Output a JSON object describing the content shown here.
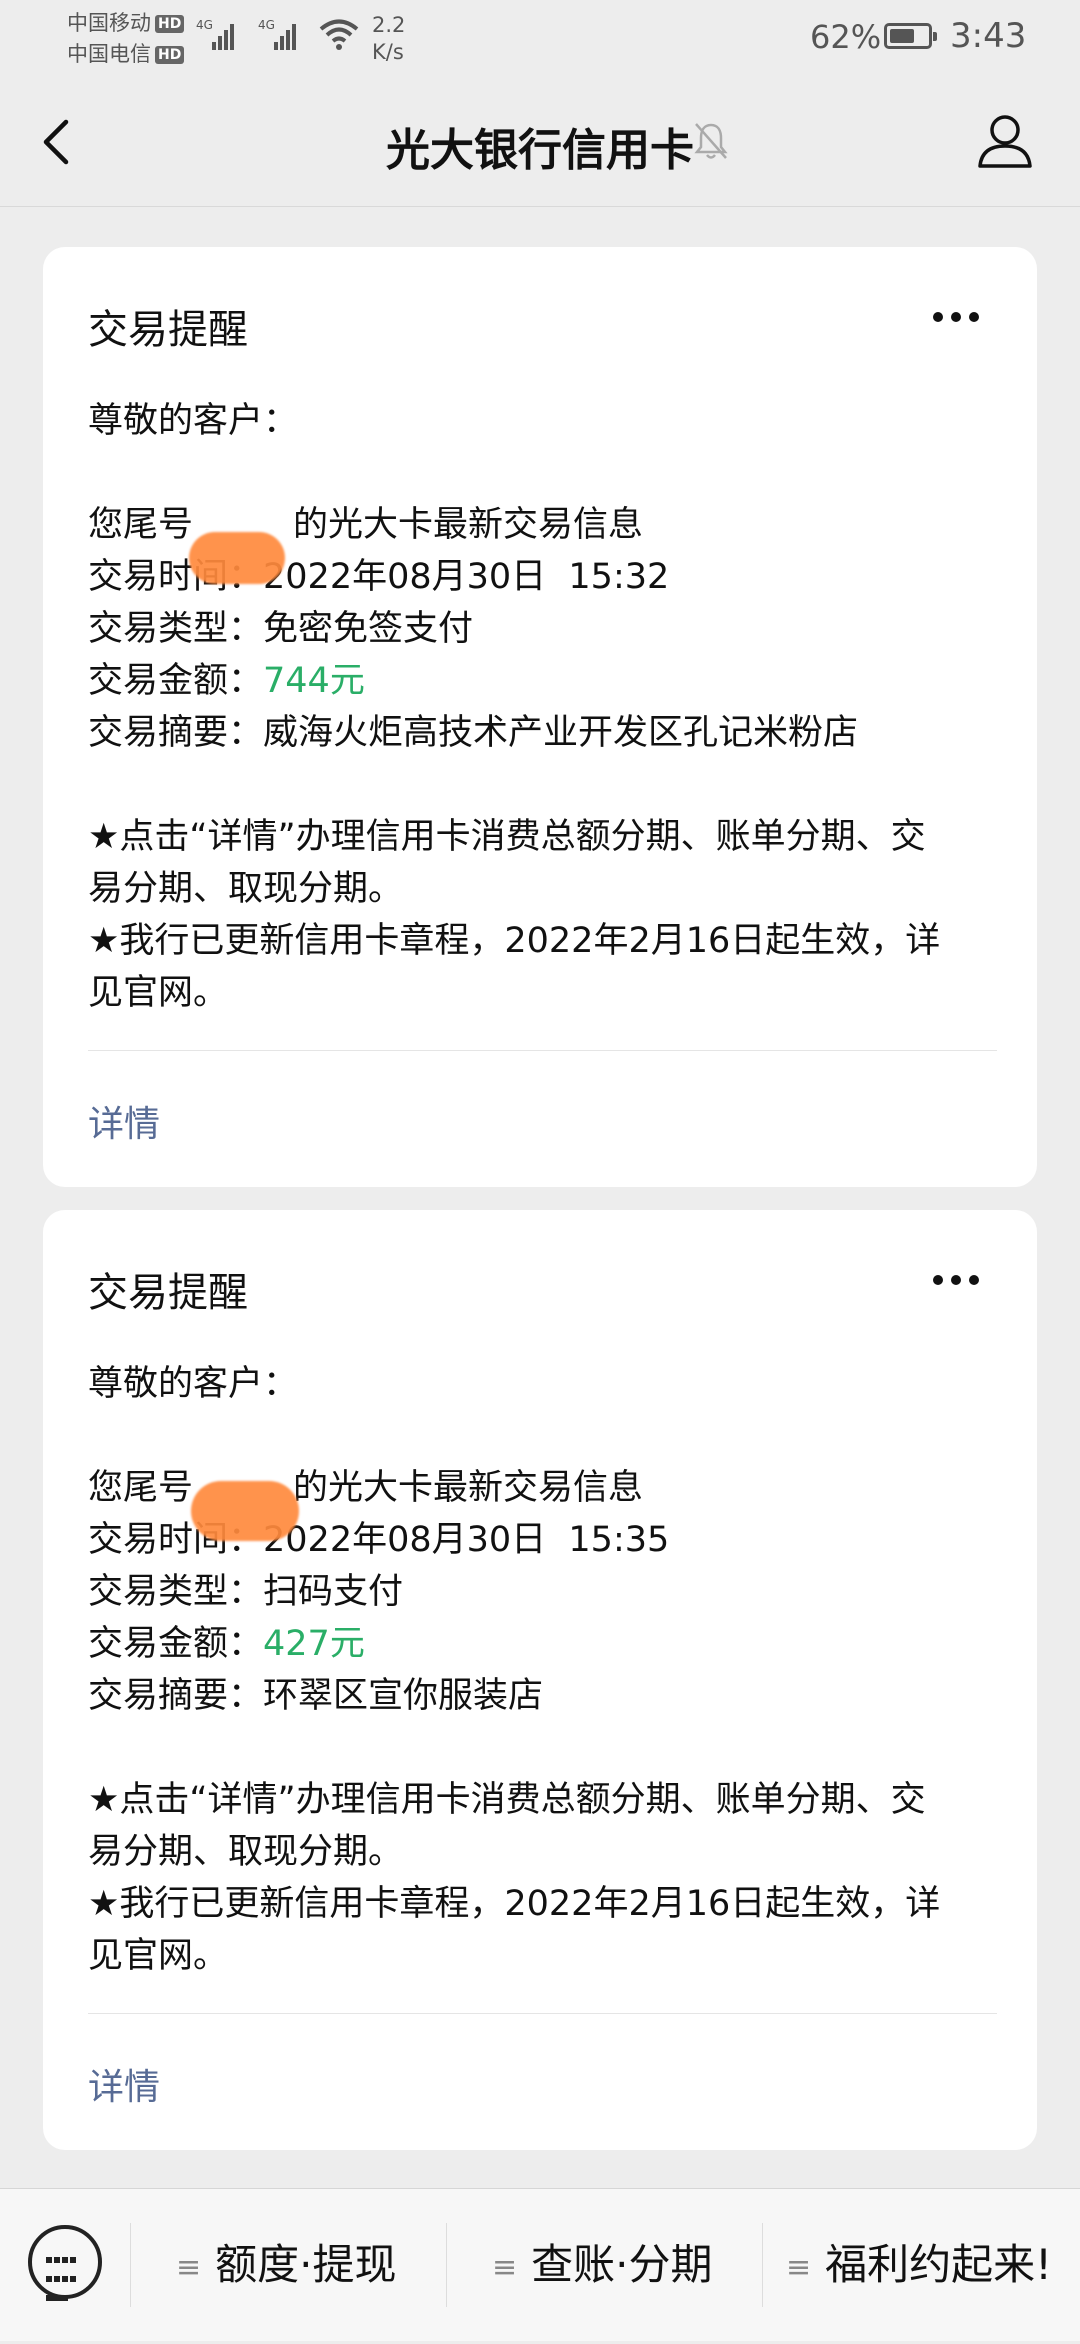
{
  "status_bar": {
    "carrier1": "中国移动",
    "carrier2": "中国电信",
    "hd_badge": "HD",
    "network_type": "4G",
    "speed_value": "2.2",
    "speed_unit": "K/s",
    "battery_percent": "62%",
    "battery_level": 0.62,
    "time": "3:43"
  },
  "header": {
    "title": "光大银行信用卡",
    "icons": [
      "back-icon",
      "muted-bell-icon",
      "person-icon"
    ]
  },
  "cards": [
    {
      "title": "交易提醒",
      "greeting": "尊敬的客户：",
      "card_line_prefix": "您尾号",
      "card_line_suffix": "的光大卡最新交易信息",
      "time_label": "交易时间：",
      "time_value": "2022年08月30日  15:32",
      "type_label": "交易类型：",
      "type_value": "免密免签支付",
      "amount_label": "交易金额：",
      "amount_value": "744元",
      "summary_label": "交易摘要：",
      "summary_value": "威海火炬高技术产业开发区孔记米粉店",
      "notice1_line1": "★点击“详情”办理信用卡消费总额分期、账单分期、交",
      "notice1_line2": "易分期、取现分期。",
      "notice2_line1": "★我行已更新信用卡章程，2022年2月16日起生效，详",
      "notice2_line2": "见官网。",
      "details_link": "详情"
    },
    {
      "title": "交易提醒",
      "greeting": "尊敬的客户：",
      "card_line_prefix": "您尾号",
      "card_line_suffix": "的光大卡最新交易信息",
      "time_label": "交易时间：",
      "time_value": "2022年08月30日  15:35",
      "type_label": "交易类型：",
      "type_value": "扫码支付",
      "amount_label": "交易金额：",
      "amount_value": "427元",
      "summary_label": "交易摘要：",
      "summary_value": "环翠区宣你服装店",
      "notice1_line1": "★点击“详情”办理信用卡消费总额分期、账单分期、交",
      "notice1_line2": "易分期、取现分期。",
      "notice2_line1": "★我行已更新信用卡章程，2022年2月16日起生效，详",
      "notice2_line2": "见官网。",
      "details_link": "详情"
    }
  ],
  "bottom_menu": {
    "items": [
      "额度·提现",
      "查账·分期",
      "福利约起来!"
    ],
    "icons": [
      "keyboard-icon",
      "menu-lines-icon"
    ]
  },
  "colors": {
    "amount": "#2aae67",
    "link": "#576b95",
    "background": "#ededed",
    "redaction": "#ff8a3d"
  }
}
